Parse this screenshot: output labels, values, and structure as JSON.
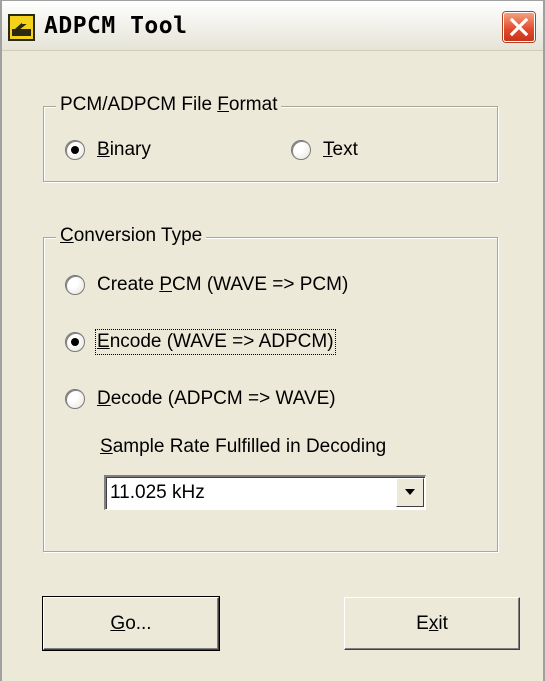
{
  "window": {
    "title": "ADPCM Tool"
  },
  "file_format": {
    "legend_pre": "PCM/ADPCM File ",
    "legend_key": "F",
    "legend_post": "ormat",
    "binary": {
      "key": "B",
      "rest": "inary",
      "checked": true
    },
    "text": {
      "key": "T",
      "rest": "ext",
      "checked": false
    }
  },
  "conversion": {
    "legend_key": "C",
    "legend_post": "onversion Type",
    "create": {
      "pre": "Create ",
      "key": "P",
      "post": "CM  (WAVE => PCM)",
      "checked": false
    },
    "encode": {
      "key": "E",
      "post": "ncode  (WAVE => ADPCM)",
      "checked": true
    },
    "decode": {
      "key": "D",
      "post": "ecode  (ADPCM => WAVE)",
      "checked": false
    },
    "sample_rate_label_key": "S",
    "sample_rate_label_post": "ample Rate Fulfilled in Decoding",
    "sample_rate_value": "11.025 kHz"
  },
  "buttons": {
    "go": {
      "key": "G",
      "post": "o..."
    },
    "exit": {
      "pre": "E",
      "key": "x",
      "post": "it"
    }
  },
  "icons": {
    "app": "app-icon",
    "close": "close-icon",
    "dropdown": "chevron-down-icon"
  }
}
